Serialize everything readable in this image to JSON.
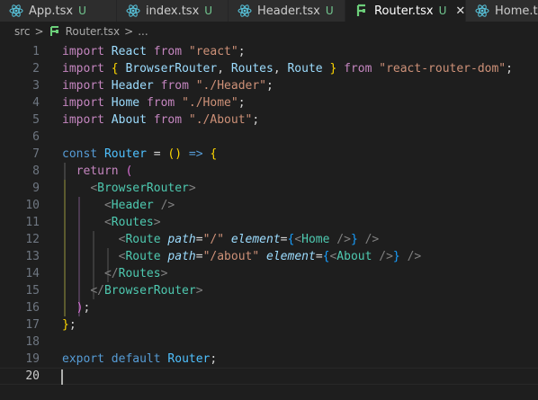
{
  "tabs": [
    {
      "name": "App.tsx",
      "status": "U",
      "active": false,
      "icon": "react-icon"
    },
    {
      "name": "index.tsx",
      "status": "U",
      "active": false,
      "icon": "react-icon"
    },
    {
      "name": "Header.tsx",
      "status": "U",
      "active": false,
      "icon": "react-icon"
    },
    {
      "name": "Router.tsx",
      "status": "U",
      "active": true,
      "icon": "router-icon",
      "close": "✕"
    },
    {
      "name": "Home.tsx",
      "status": "",
      "active": false,
      "icon": "react-icon"
    }
  ],
  "breadcrumb": {
    "folder": "src",
    "file": "Router.tsx",
    "more": "...",
    "separator": ">"
  },
  "editor": {
    "current_line": 20,
    "lines": [
      {
        "n": 1,
        "tokens": [
          [
            "kw2",
            "import"
          ],
          [
            "op",
            " "
          ],
          [
            "imp",
            "React"
          ],
          [
            "op",
            " "
          ],
          [
            "kw2",
            "from"
          ],
          [
            "op",
            " "
          ],
          [
            "str",
            "\"react\""
          ],
          [
            "pun",
            ";"
          ]
        ]
      },
      {
        "n": 2,
        "tokens": [
          [
            "kw2",
            "import"
          ],
          [
            "op",
            " "
          ],
          [
            "br1",
            "{"
          ],
          [
            "op",
            " "
          ],
          [
            "imp",
            "BrowserRouter"
          ],
          [
            "pun",
            ","
          ],
          [
            "op",
            " "
          ],
          [
            "imp",
            "Routes"
          ],
          [
            "pun",
            ","
          ],
          [
            "op",
            " "
          ],
          [
            "imp",
            "Route"
          ],
          [
            "op",
            " "
          ],
          [
            "br1",
            "}"
          ],
          [
            "op",
            " "
          ],
          [
            "kw2",
            "from"
          ],
          [
            "op",
            " "
          ],
          [
            "str",
            "\"react-router-dom\""
          ],
          [
            "pun",
            ";"
          ]
        ]
      },
      {
        "n": 3,
        "tokens": [
          [
            "kw2",
            "import"
          ],
          [
            "op",
            " "
          ],
          [
            "imp",
            "Header"
          ],
          [
            "op",
            " "
          ],
          [
            "kw2",
            "from"
          ],
          [
            "op",
            " "
          ],
          [
            "str",
            "\"./Header\""
          ],
          [
            "pun",
            ";"
          ]
        ]
      },
      {
        "n": 4,
        "tokens": [
          [
            "kw2",
            "import"
          ],
          [
            "op",
            " "
          ],
          [
            "imp",
            "Home"
          ],
          [
            "op",
            " "
          ],
          [
            "kw2",
            "from"
          ],
          [
            "op",
            " "
          ],
          [
            "str",
            "\"./Home\""
          ],
          [
            "pun",
            ";"
          ]
        ]
      },
      {
        "n": 5,
        "tokens": [
          [
            "kw2",
            "import"
          ],
          [
            "op",
            " "
          ],
          [
            "imp",
            "About"
          ],
          [
            "op",
            " "
          ],
          [
            "kw2",
            "from"
          ],
          [
            "op",
            " "
          ],
          [
            "str",
            "\"./About\""
          ],
          [
            "pun",
            ";"
          ]
        ]
      },
      {
        "n": 6,
        "tokens": []
      },
      {
        "n": 7,
        "tokens": [
          [
            "kw",
            "const"
          ],
          [
            "op",
            " "
          ],
          [
            "var",
            "Router"
          ],
          [
            "op",
            " = "
          ],
          [
            "br1",
            "()"
          ],
          [
            "op",
            " "
          ],
          [
            "kw",
            "=>"
          ],
          [
            "op",
            " "
          ],
          [
            "br1",
            "{"
          ]
        ]
      },
      {
        "n": 8,
        "tokens": [
          [
            "op",
            "  "
          ],
          [
            "kw2",
            "return"
          ],
          [
            "op",
            " "
          ],
          [
            "br2",
            "("
          ]
        ]
      },
      {
        "n": 9,
        "tokens": [
          [
            "op",
            "    "
          ],
          [
            "ang",
            "<"
          ],
          [
            "tag",
            "BrowserRouter"
          ],
          [
            "ang",
            ">"
          ]
        ]
      },
      {
        "n": 10,
        "tokens": [
          [
            "op",
            "      "
          ],
          [
            "ang",
            "<"
          ],
          [
            "tag",
            "Header"
          ],
          [
            "op",
            " "
          ],
          [
            "ang",
            "/>"
          ]
        ]
      },
      {
        "n": 11,
        "tokens": [
          [
            "op",
            "      "
          ],
          [
            "ang",
            "<"
          ],
          [
            "tag",
            "Routes"
          ],
          [
            "ang",
            ">"
          ]
        ]
      },
      {
        "n": 12,
        "tokens": [
          [
            "op",
            "        "
          ],
          [
            "ang",
            "<"
          ],
          [
            "tag",
            "Route"
          ],
          [
            "op",
            " "
          ],
          [
            "attr",
            "path"
          ],
          [
            "op",
            "="
          ],
          [
            "str",
            "\"/\""
          ],
          [
            "op",
            " "
          ],
          [
            "attr",
            "element"
          ],
          [
            "op",
            "="
          ],
          [
            "br3",
            "{"
          ],
          [
            "ang",
            "<"
          ],
          [
            "tag",
            "Home"
          ],
          [
            "op",
            " "
          ],
          [
            "ang",
            "/>"
          ],
          [
            "br3",
            "}"
          ],
          [
            "op",
            " "
          ],
          [
            "ang",
            "/>"
          ]
        ]
      },
      {
        "n": 13,
        "tokens": [
          [
            "op",
            "        "
          ],
          [
            "ang",
            "<"
          ],
          [
            "tag",
            "Route"
          ],
          [
            "op",
            " "
          ],
          [
            "attr",
            "path"
          ],
          [
            "op",
            "="
          ],
          [
            "str",
            "\"/about\""
          ],
          [
            "op",
            " "
          ],
          [
            "attr",
            "element"
          ],
          [
            "op",
            "="
          ],
          [
            "br3",
            "{"
          ],
          [
            "ang",
            "<"
          ],
          [
            "tag",
            "About"
          ],
          [
            "op",
            " "
          ],
          [
            "ang",
            "/>"
          ],
          [
            "br3",
            "}"
          ],
          [
            "op",
            " "
          ],
          [
            "ang",
            "/>"
          ]
        ]
      },
      {
        "n": 14,
        "tokens": [
          [
            "op",
            "      "
          ],
          [
            "ang",
            "</"
          ],
          [
            "tag",
            "Routes"
          ],
          [
            "ang",
            ">"
          ]
        ]
      },
      {
        "n": 15,
        "tokens": [
          [
            "op",
            "    "
          ],
          [
            "ang",
            "</"
          ],
          [
            "tag",
            "BrowserRouter"
          ],
          [
            "ang",
            ">"
          ]
        ]
      },
      {
        "n": 16,
        "tokens": [
          [
            "op",
            "  "
          ],
          [
            "br2",
            ")"
          ],
          [
            "pun",
            ";"
          ]
        ]
      },
      {
        "n": 17,
        "tokens": [
          [
            "br1",
            "}"
          ],
          [
            "pun",
            ";"
          ]
        ]
      },
      {
        "n": 18,
        "tokens": []
      },
      {
        "n": 19,
        "tokens": [
          [
            "kw",
            "export"
          ],
          [
            "op",
            " "
          ],
          [
            "kw",
            "default"
          ],
          [
            "op",
            " "
          ],
          [
            "var",
            "Router"
          ],
          [
            "pun",
            ";"
          ]
        ]
      },
      {
        "n": 20,
        "tokens": []
      }
    ]
  },
  "colors": {
    "background": "#1e1e1e",
    "untracked": "#73c991",
    "react_icon": "#58c4dc",
    "router_icon": "#6ccf7a"
  }
}
